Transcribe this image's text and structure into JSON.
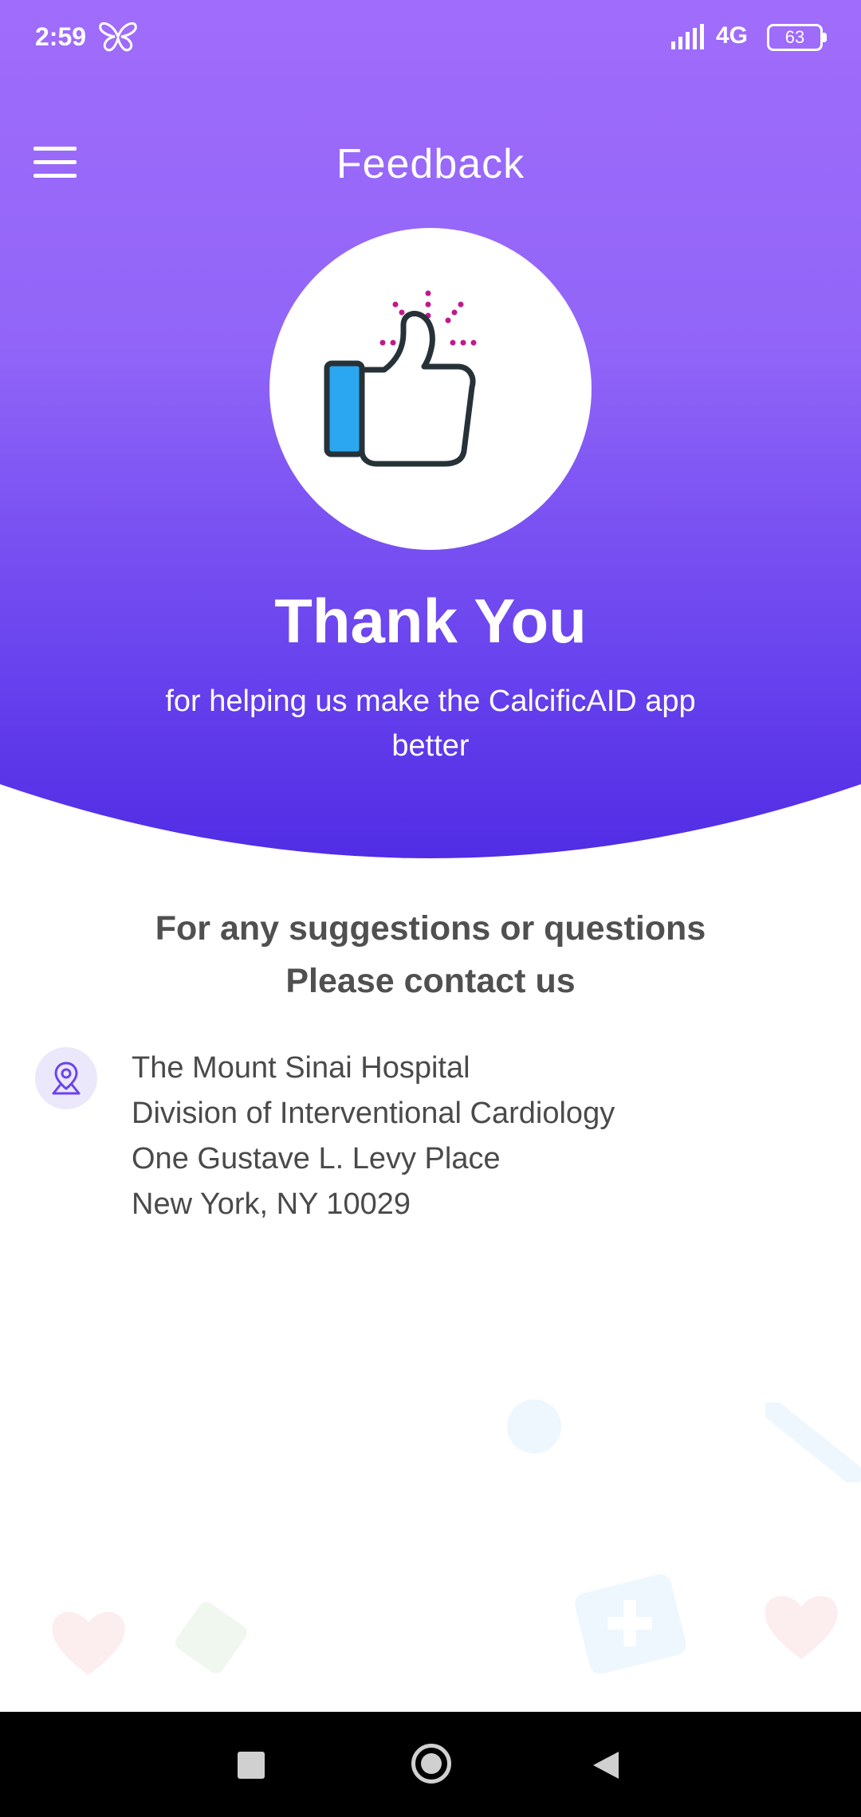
{
  "status_bar": {
    "time": "2:59",
    "network": "4G",
    "battery": "63"
  },
  "app_bar": {
    "title": "Feedback",
    "menu_icon": "hamburger-menu-icon"
  },
  "hero": {
    "icon": "thumbs-up-icon",
    "heading": "Thank You",
    "subtitle": "for helping us make the CalcificAID app better"
  },
  "contact": {
    "heading_line1": "For any suggestions or questions",
    "heading_line2": "Please contact us",
    "icon": "location-pin-icon",
    "address": [
      "The Mount Sinai Hospital",
      "Division of Interventional Cardiology",
      "One Gustave L. Levy Place",
      "New York, NY 10029"
    ]
  },
  "colors": {
    "header_top": "#a06cfb",
    "header_bottom": "#4f2be4",
    "thumb_accent": "#2aa7f0",
    "sparkle": "#c2188b"
  },
  "nav_bar": {
    "recents_icon": "square-recents-icon",
    "home_icon": "circle-home-icon",
    "back_icon": "triangle-back-icon"
  }
}
